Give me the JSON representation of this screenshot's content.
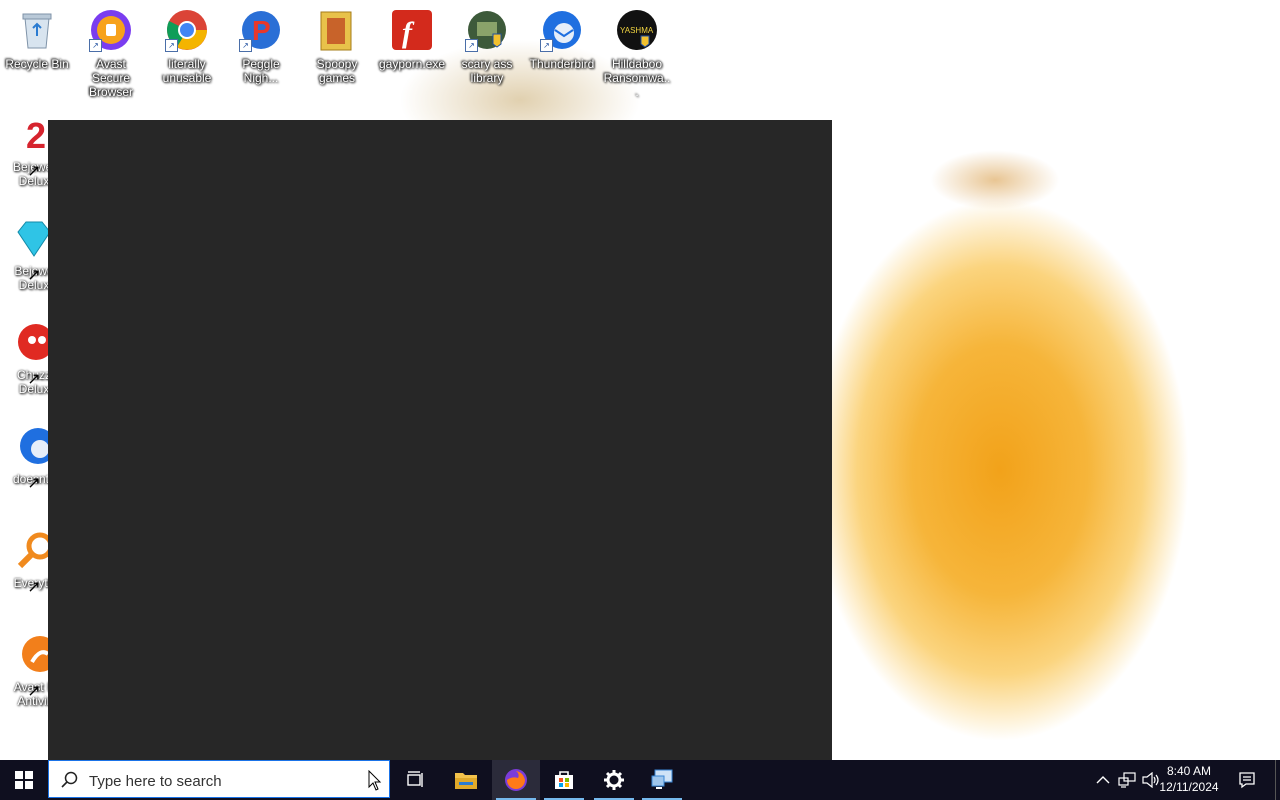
{
  "desktop": {
    "top_icons": [
      {
        "name": "recycle-bin",
        "label": "Recycle Bin",
        "shortcut": false
      },
      {
        "name": "avast-secure-browser",
        "label": "Avast Secure\nBrowser",
        "shortcut": true
      },
      {
        "name": "literally-unusable",
        "label": "literally\nunusable",
        "shortcut": true
      },
      {
        "name": "peggle-nights",
        "label": "Peggle\nNigh...",
        "shortcut": true
      },
      {
        "name": "spoopy-games",
        "label": "Spoopy\ngames",
        "shortcut": false
      },
      {
        "name": "gayporn-exe",
        "label": "gayporn.exe",
        "shortcut": false
      },
      {
        "name": "scary-ass-library",
        "label": "scary ass\nlibrary",
        "shortcut": true
      },
      {
        "name": "thunderbird",
        "label": "Thunderbird",
        "shortcut": true
      },
      {
        "name": "hilldaboo-ransomware",
        "label": "Hilldaboo\nRansomwa...",
        "shortcut": false
      }
    ],
    "left_icons": [
      {
        "name": "bejeweled-2-deluxe",
        "label": "Bejewel\nDelux"
      },
      {
        "name": "bejeweled-deluxe",
        "label": "Bejewe\nDelux"
      },
      {
        "name": "chuzzle-deluxe",
        "label": "Chuzz\nDelux"
      },
      {
        "name": "doesnt-launch",
        "label": "doesnt l"
      },
      {
        "name": "everything",
        "label": "Everyth"
      },
      {
        "name": "avast-free-antivirus",
        "label": "Avast F\nAntivir"
      }
    ]
  },
  "taskbar": {
    "search": {
      "placeholder": "Type here to search",
      "value": ""
    },
    "apps": [
      "task-view",
      "file-explorer",
      "firefox",
      "microsoft-store",
      "settings",
      "remote-desktop"
    ],
    "clock": {
      "time": "8:40 AM",
      "date": "12/11/2024"
    }
  },
  "colors": {
    "taskbar": "#0f0f1f",
    "window": "#272727",
    "accent": "#76b9ed"
  }
}
